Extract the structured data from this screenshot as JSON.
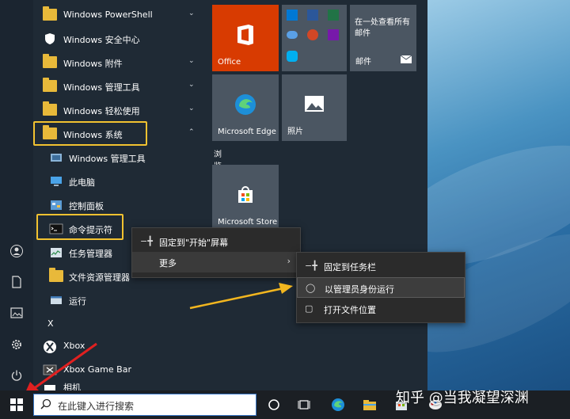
{
  "start_list": {
    "items": [
      {
        "label": "Windows PowerShell"
      },
      {
        "label": "Windows 安全中心"
      },
      {
        "label": "Windows 附件"
      },
      {
        "label": "Windows 管理工具"
      },
      {
        "label": "Windows 轻松使用"
      },
      {
        "label": "Windows 系统"
      },
      {
        "label": "Windows 管理工具"
      },
      {
        "label": "此电脑"
      },
      {
        "label": "控制面板"
      },
      {
        "label": "命令提示符"
      },
      {
        "label": "任务管理器"
      },
      {
        "label": "文件资源管理器"
      },
      {
        "label": "运行"
      },
      {
        "label": "X"
      },
      {
        "label": "Xbox"
      },
      {
        "label": "Xbox Game Bar"
      },
      {
        "label": "相机"
      }
    ]
  },
  "tiles": {
    "office": "Office",
    "mail_text": "在一处查看所有邮件",
    "mail": "邮件",
    "edge": "Microsoft Edge",
    "photos": "照片",
    "group_label": "浏览",
    "store": "Microsoft Store"
  },
  "context_menu": {
    "pin_start": "固定到\"开始\"屏幕",
    "more": "更多"
  },
  "submenu": {
    "pin_taskbar": "固定到任务栏",
    "run_admin": "以管理员身份运行",
    "open_location": "打开文件位置"
  },
  "taskbar": {
    "search_placeholder": "在此键入进行搜索"
  },
  "watermark": "知乎 @当我凝望深渊",
  "colors": {
    "highlight": "#f2c230",
    "arrow_yellow": "#f2b61f",
    "arrow_red": "#e02020",
    "office_tile": "#d83b01",
    "accent_blue": "#3a78c8"
  }
}
